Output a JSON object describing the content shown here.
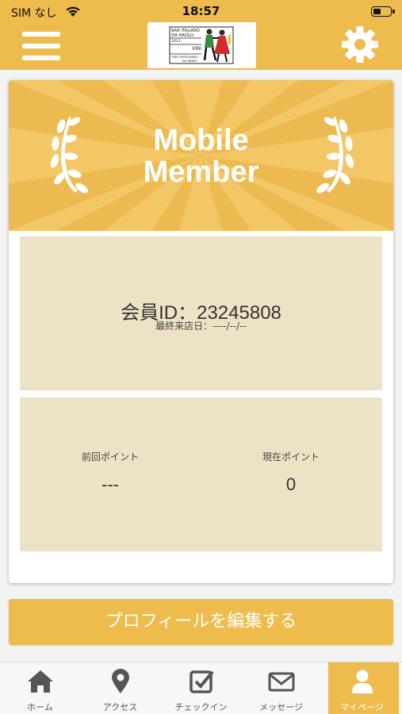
{
  "status_bar": {
    "carrier": "SIM なし",
    "time": "18:57"
  },
  "header": {
    "logo_lines": [
      "BAR ITALIANO",
      "DA PAOLO",
      "2013",
      "VINI",
      "VINO ARTIGIANALI",
      "Est.MMXIII"
    ],
    "menu_icon": "hamburger-icon",
    "settings_icon": "gear-icon"
  },
  "card": {
    "title_line1": "Mobile",
    "title_line2": "Member",
    "member_id_label": "会員ID：",
    "member_id": "23245808",
    "last_visit_label": "最終来店日：",
    "last_visit_value": "----/--/--",
    "points": {
      "previous_label": "前回ポイント",
      "previous_value": "---",
      "current_label": "現在ポイント",
      "current_value": "0"
    }
  },
  "edit_profile_label": "プロフィールを編集する",
  "tabs": [
    {
      "label": "ホーム",
      "icon": "home-icon",
      "active": false
    },
    {
      "label": "アクセス",
      "icon": "map-pin-icon",
      "active": false
    },
    {
      "label": "チェックイン",
      "icon": "checkbox-icon",
      "active": false
    },
    {
      "label": "メッセージ",
      "icon": "envelope-icon",
      "active": false
    },
    {
      "label": "マイページ",
      "icon": "user-icon",
      "active": true
    }
  ],
  "colors": {
    "accent": "#eebb4d",
    "panel": "#eee2c6"
  }
}
